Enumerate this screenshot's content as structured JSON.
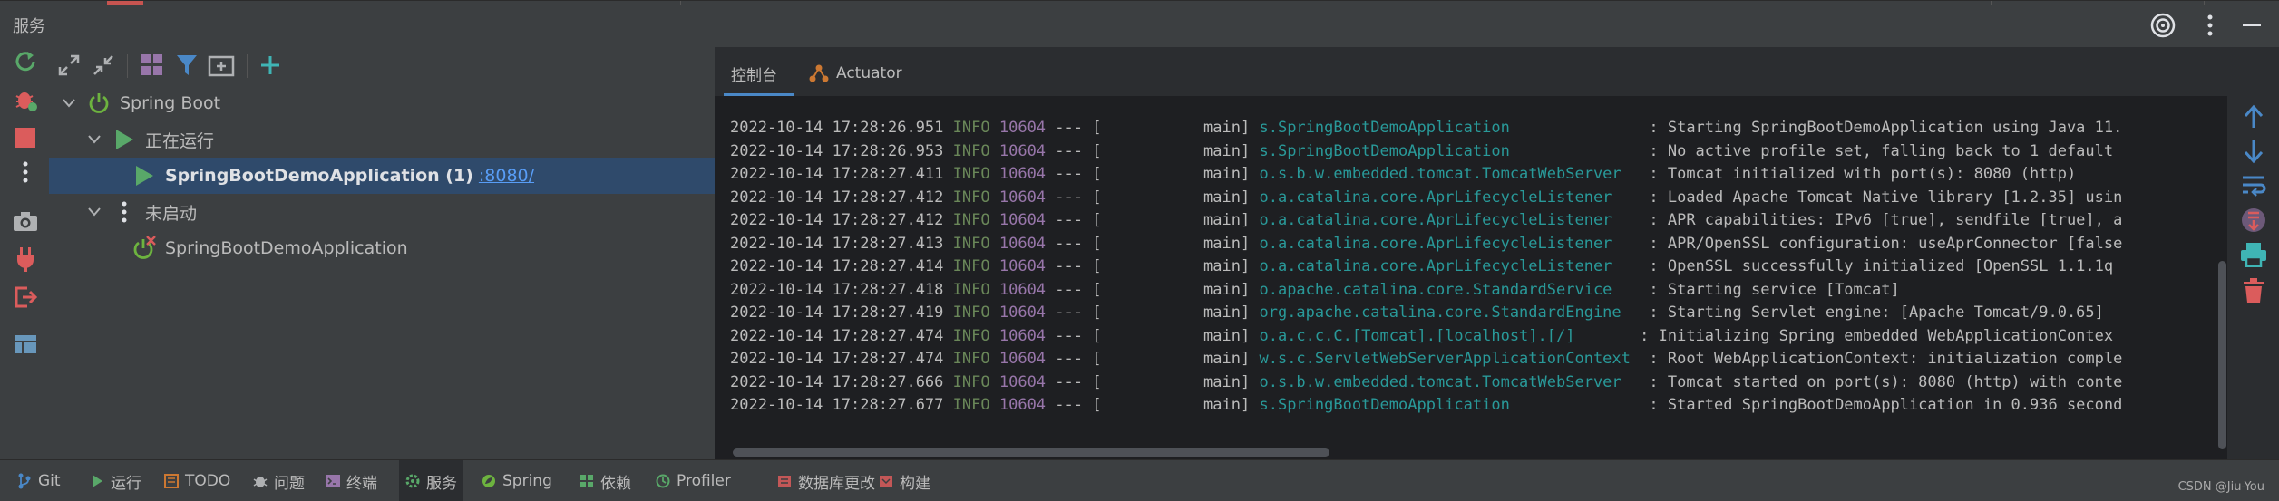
{
  "window": {
    "panel_title": "服务"
  },
  "tree": {
    "root_label": "Spring Boot",
    "running_group": "正在运行",
    "running_app": "SpringBootDemoApplication (1)",
    "running_port": ":8080/",
    "stopped_group": "未启动",
    "stopped_app": "SpringBootDemoApplication"
  },
  "tabs": {
    "console": "控制台",
    "actuator": "Actuator"
  },
  "log": [
    {
      "ts": "2022-10-14 17:28:26.951",
      "level": "INFO",
      "pid": "10604",
      "sep": "--- [           main]",
      "logger": "s.SpringBootDemoApplication              ",
      "msg": ": Starting SpringBootDemoApplication using Java 11."
    },
    {
      "ts": "2022-10-14 17:28:26.953",
      "level": "INFO",
      "pid": "10604",
      "sep": "--- [           main]",
      "logger": "s.SpringBootDemoApplication              ",
      "msg": ": No active profile set, falling back to 1 default "
    },
    {
      "ts": "2022-10-14 17:28:27.411",
      "level": "INFO",
      "pid": "10604",
      "sep": "--- [           main]",
      "logger": "o.s.b.w.embedded.tomcat.TomcatWebServer  ",
      "msg": ": Tomcat initialized with port(s): 8080 (http)"
    },
    {
      "ts": "2022-10-14 17:28:27.412",
      "level": "INFO",
      "pid": "10604",
      "sep": "--- [           main]",
      "logger": "o.a.catalina.core.AprLifecycleListener   ",
      "msg": ": Loaded Apache Tomcat Native library [1.2.35] usin"
    },
    {
      "ts": "2022-10-14 17:28:27.412",
      "level": "INFO",
      "pid": "10604",
      "sep": "--- [           main]",
      "logger": "o.a.catalina.core.AprLifecycleListener   ",
      "msg": ": APR capabilities: IPv6 [true], sendfile [true], a"
    },
    {
      "ts": "2022-10-14 17:28:27.413",
      "level": "INFO",
      "pid": "10604",
      "sep": "--- [           main]",
      "logger": "o.a.catalina.core.AprLifecycleListener   ",
      "msg": ": APR/OpenSSL configuration: useAprConnector [false"
    },
    {
      "ts": "2022-10-14 17:28:27.414",
      "level": "INFO",
      "pid": "10604",
      "sep": "--- [           main]",
      "logger": "o.a.catalina.core.AprLifecycleListener   ",
      "msg": ": OpenSSL successfully initialized [OpenSSL 1.1.1q"
    },
    {
      "ts": "2022-10-14 17:28:27.418",
      "level": "INFO",
      "pid": "10604",
      "sep": "--- [           main]",
      "logger": "o.apache.catalina.core.StandardService   ",
      "msg": ": Starting service [Tomcat]"
    },
    {
      "ts": "2022-10-14 17:28:27.419",
      "level": "INFO",
      "pid": "10604",
      "sep": "--- [           main]",
      "logger": "org.apache.catalina.core.StandardEngine  ",
      "msg": ": Starting Servlet engine: [Apache Tomcat/9.0.65]"
    },
    {
      "ts": "2022-10-14 17:28:27.474",
      "level": "INFO",
      "pid": "10604",
      "sep": "--- [           main]",
      "logger": "o.a.c.c.C.[Tomcat].[localhost].[/]      ",
      "msg": ": Initializing Spring embedded WebApplicationContex"
    },
    {
      "ts": "2022-10-14 17:28:27.474",
      "level": "INFO",
      "pid": "10604",
      "sep": "--- [           main]",
      "logger": "w.s.c.ServletWebServerApplicationContext ",
      "msg": ": Root WebApplicationContext: initialization comple"
    },
    {
      "ts": "2022-10-14 17:28:27.666",
      "level": "INFO",
      "pid": "10604",
      "sep": "--- [           main]",
      "logger": "o.s.b.w.embedded.tomcat.TomcatWebServer  ",
      "msg": ": Tomcat started on port(s): 8080 (http) with conte"
    },
    {
      "ts": "2022-10-14 17:28:27.677",
      "level": "INFO",
      "pid": "10604",
      "sep": "--- [           main]",
      "logger": "s.SpringBootDemoApplication              ",
      "msg": ": Started SpringBootDemoApplication in 0.936 second"
    }
  ],
  "statusbar": {
    "items": [
      {
        "label": "Git",
        "icon": "git-branch-icon"
      },
      {
        "label": "运行",
        "icon": "run-icon"
      },
      {
        "label": "TODO",
        "icon": "todo-icon"
      },
      {
        "label": "问题",
        "icon": "problems-icon"
      },
      {
        "label": "终端",
        "icon": "terminal-icon"
      },
      {
        "label": "服务",
        "icon": "services-icon"
      },
      {
        "label": "Spring",
        "icon": "spring-icon"
      },
      {
        "label": "依赖",
        "icon": "dependencies-icon"
      },
      {
        "label": "Profiler",
        "icon": "profiler-icon"
      },
      {
        "label": "数据库更改",
        "icon": "database-changes-icon"
      },
      {
        "label": "构建",
        "icon": "build-icon"
      }
    ],
    "watermark": "CSDN @Jiu-You"
  },
  "colors": {
    "accent": "#4a88c7",
    "run_green": "#59a869",
    "info_green": "#6a8759",
    "pid_purple": "#9876aa",
    "logger_teal": "#299999",
    "stop_red": "#db5c5c",
    "selection": "#2f4a6b"
  }
}
